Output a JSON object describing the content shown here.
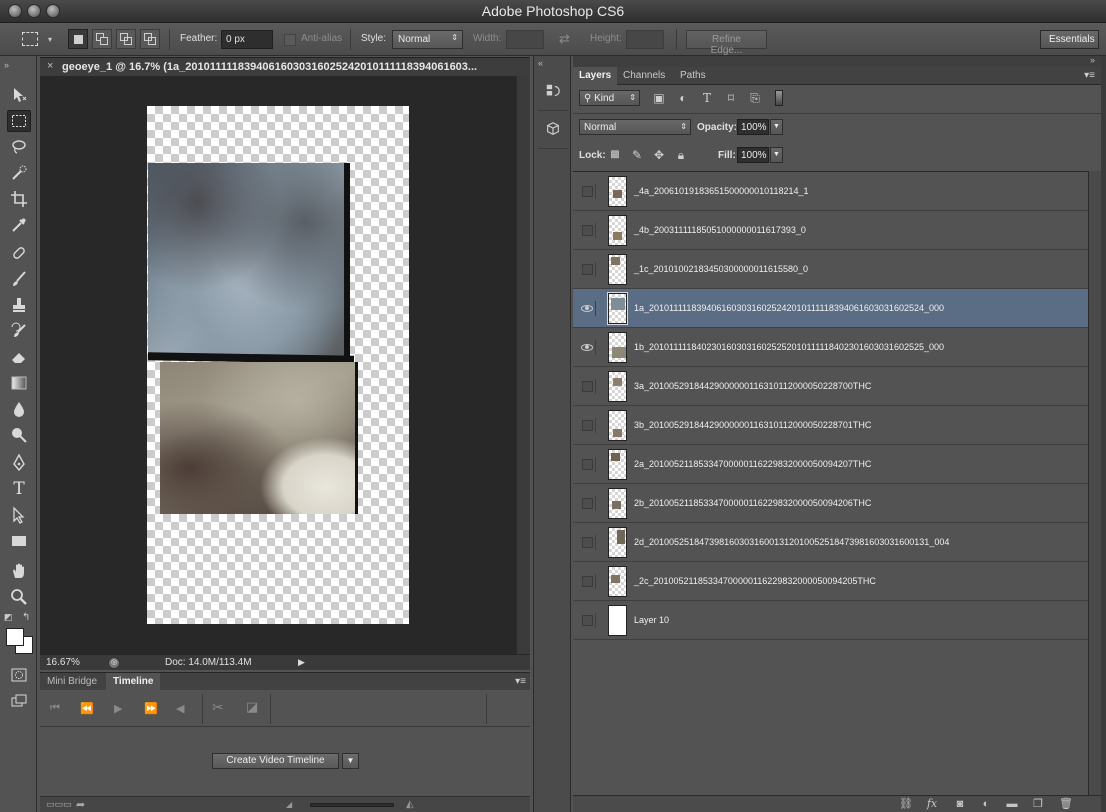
{
  "app": {
    "title": "Adobe Photoshop CS6"
  },
  "options_bar": {
    "feather_label": "Feather:",
    "feather_value": "0 px",
    "anti_alias_label": "Anti-alias",
    "style_label": "Style:",
    "style_value": "Normal",
    "width_label": "Width:",
    "height_label": "Height:",
    "refine_edge_label": "Refine Edge...",
    "workspace_label": "Essentials"
  },
  "document": {
    "tab_title": "geoeye_1 @ 16.7% (1a_20101111183940616030316025242010111118394061603...",
    "zoom": "16.67%",
    "doc_size": "Doc: 14.0M/113.4M"
  },
  "bottom_panel": {
    "tabs": [
      "Mini Bridge",
      "Timeline"
    ],
    "active_tab": "Timeline",
    "create_button": "Create Video Timeline"
  },
  "layers_panel": {
    "tabs": [
      "Layers",
      "Channels",
      "Paths"
    ],
    "active_tab": "Layers",
    "filter_kind": "Kind",
    "blend_mode": "Normal",
    "opacity_label": "Opacity:",
    "opacity": "100%",
    "lock_label": "Lock:",
    "fill_label": "Fill:",
    "fill": "100%",
    "layers": [
      {
        "name": "_4a_20061019183651500000010118214_1",
        "visible": false,
        "selected": false
      },
      {
        "name": "_4b_20031111185051000000011617393_0",
        "visible": false,
        "selected": false
      },
      {
        "name": "_1c_20101002183450300000011615580_0",
        "visible": false,
        "selected": false
      },
      {
        "name": "1a_20101111183940616030316025242010111118394061603031602524_000",
        "visible": true,
        "selected": true
      },
      {
        "name": "1b_20101111184023016030316025252010111118402301603031602525_000",
        "visible": true,
        "selected": false
      },
      {
        "name": "3a_20100529184429000000116310112000050228700THC",
        "visible": false,
        "selected": false
      },
      {
        "name": "3b_20100529184429000000116310112000050228701THC",
        "visible": false,
        "selected": false
      },
      {
        "name": "2a_20100521185334700000116229832000050094207THC",
        "visible": false,
        "selected": false
      },
      {
        "name": "2b_20100521185334700000116229832000050094206THC",
        "visible": false,
        "selected": false
      },
      {
        "name": "2d_20100525184739816030316001312010052518473981603031600131_004",
        "visible": false,
        "selected": false
      },
      {
        "name": "_2c_20100521185334700000116229832000050094205THC",
        "visible": false,
        "selected": false
      },
      {
        "name": "Layer 10",
        "visible": false,
        "selected": false
      }
    ]
  },
  "colors": {
    "selected_row": "#5b6d85",
    "panel_bg": "#535353",
    "canvas_bg": "#282828"
  }
}
